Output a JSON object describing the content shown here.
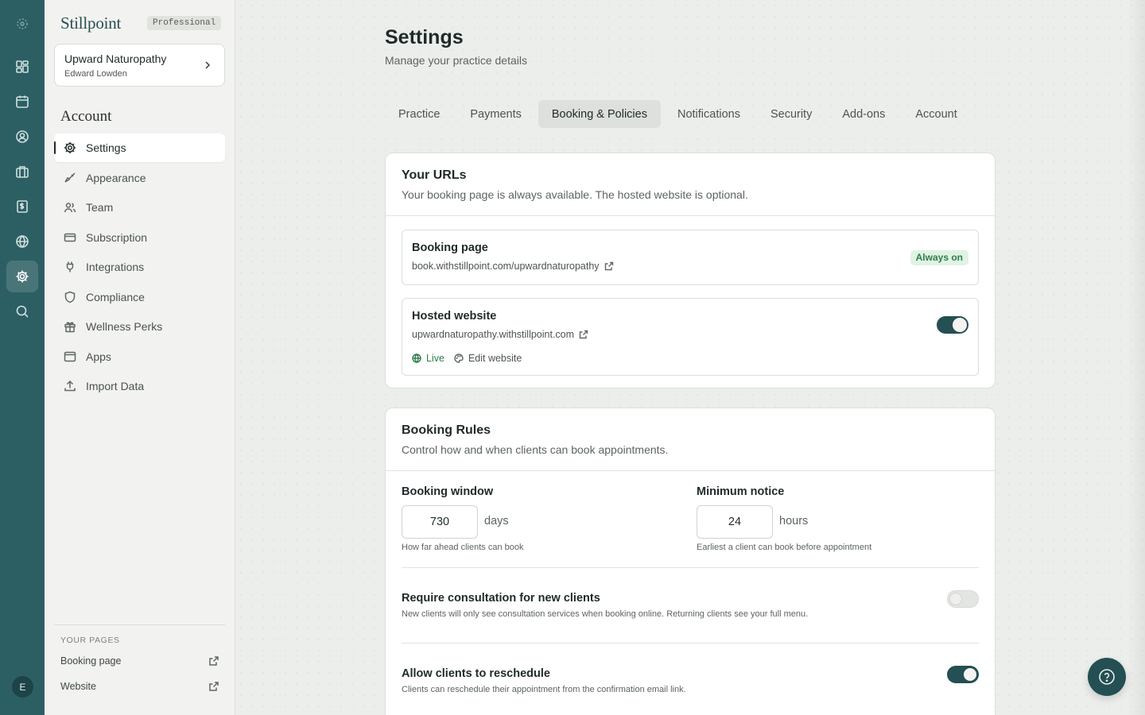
{
  "app": {
    "brand": "Stillpoint",
    "plan": "Professional",
    "user_initial": "E"
  },
  "practice": {
    "name": "Upward Naturopathy",
    "owner": "Edward Lowden"
  },
  "sidebar": {
    "section_title": "Account",
    "items": [
      {
        "label": "Settings",
        "icon": "gear-icon",
        "active": true
      },
      {
        "label": "Appearance",
        "icon": "brush-icon"
      },
      {
        "label": "Team",
        "icon": "users-icon"
      },
      {
        "label": "Subscription",
        "icon": "credit-card-icon"
      },
      {
        "label": "Integrations",
        "icon": "plug-icon"
      },
      {
        "label": "Compliance",
        "icon": "shield-icon"
      },
      {
        "label": "Wellness Perks",
        "icon": "gift-icon"
      },
      {
        "label": "Apps",
        "icon": "window-icon"
      },
      {
        "label": "Import Data",
        "icon": "upload-icon"
      }
    ],
    "pages_label": "YOUR PAGES",
    "pages": [
      {
        "label": "Booking page"
      },
      {
        "label": "Website"
      }
    ]
  },
  "rail": {
    "icons": [
      "dashboard-icon",
      "calendar-icon",
      "client-icon",
      "briefcase-icon",
      "invoice-icon",
      "globe-icon",
      "gear-icon",
      "search-icon"
    ],
    "active": "gear-icon"
  },
  "header": {
    "title": "Settings",
    "subtitle": "Manage your practice details"
  },
  "tabs": [
    {
      "label": "Practice"
    },
    {
      "label": "Payments"
    },
    {
      "label": "Booking & Policies",
      "active": true
    },
    {
      "label": "Notifications"
    },
    {
      "label": "Security"
    },
    {
      "label": "Add-ons"
    },
    {
      "label": "Account"
    }
  ],
  "urls_card": {
    "title": "Your URLs",
    "desc": "Your booking page is always available. The hosted website is optional.",
    "booking": {
      "title": "Booking page",
      "url": "book.withstillpoint.com/upwardnaturopathy",
      "badge": "Always on"
    },
    "website": {
      "title": "Hosted website",
      "url": "upwardnaturopathy.withstillpoint.com",
      "enabled": true,
      "live_label": "Live",
      "edit_label": "Edit website"
    }
  },
  "rules_card": {
    "title": "Booking Rules",
    "desc": "Control how and when clients can book appointments.",
    "booking_window": {
      "label": "Booking window",
      "value": "730",
      "unit": "days",
      "hint": "How far ahead clients can book"
    },
    "min_notice": {
      "label": "Minimum notice",
      "value": "24",
      "unit": "hours",
      "hint": "Earliest a client can book before appointment"
    },
    "consultation": {
      "title": "Require consultation for new clients",
      "desc": "New clients will only see consultation services when booking online. Returning clients see your full menu.",
      "enabled": false
    },
    "reschedule": {
      "title": "Allow clients to reschedule",
      "desc": "Clients can reschedule their appointment from the confirmation email link.",
      "enabled": true
    }
  },
  "colors": {
    "rail": "#2c5f63",
    "accent": "#244f53",
    "success": "#2e7d4a"
  }
}
